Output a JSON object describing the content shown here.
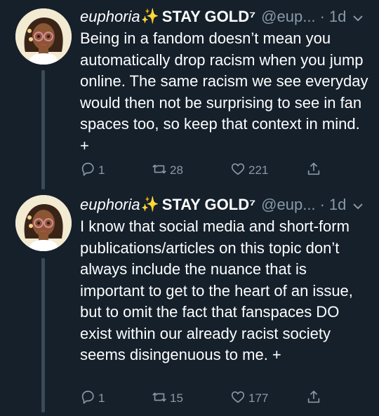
{
  "tweets": [
    {
      "display_name_italic": "euphoria",
      "sparkle": "✨",
      "display_name_bold": "STAY GOLD⁷",
      "handle": "@eup...",
      "time": "1d",
      "text": "Being in a fandom doesn’t mean you automatically drop racism when you jump online. The same racism we see everyday would then not be surprising to see in fan spaces too, so keep that context in mind. +",
      "replies": "1",
      "retweets": "28",
      "likes": "221"
    },
    {
      "display_name_italic": "euphoria",
      "sparkle": "✨",
      "display_name_bold": "STAY GOLD⁷",
      "handle": "@eup...",
      "time": "1d",
      "text": "I know that social media and short-form publications/articles on this topic don’t always include the nuance that is important to get to the heart of an issue, but to omit the fact that fanspaces DO exist within our already racist society seems disingenuous to me. +",
      "replies": "1",
      "retweets": "15",
      "likes": "177"
    }
  ],
  "colors": {
    "background": "#15202b",
    "secondary_text": "#8899a6",
    "thread_line": "#3b4a57",
    "sparkle": "#ffd34e"
  },
  "icons": [
    "avatar",
    "chevron-down-icon",
    "reply-icon",
    "retweet-icon",
    "like-icon",
    "share-icon"
  ]
}
